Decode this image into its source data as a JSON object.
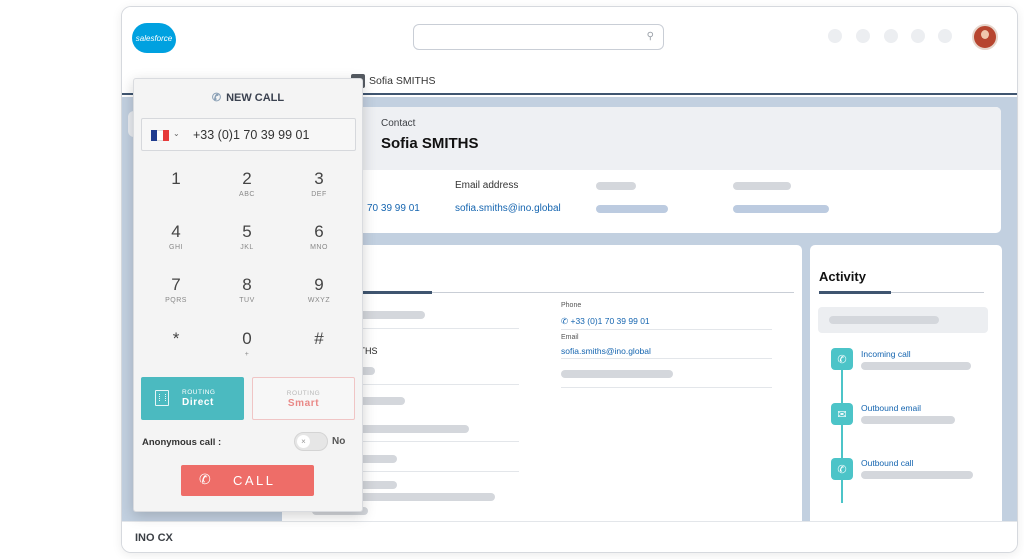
{
  "header": {
    "logo_text": "salesforce",
    "search_icon": "search-icon"
  },
  "tab": {
    "label": "Sofia SMITHS"
  },
  "contact": {
    "kicker": "Contact",
    "name": "Sofia SMITHS",
    "email_label": "Email address",
    "phone_value": "70 39 99 01",
    "email_value": "sofia.smiths@ino.global"
  },
  "details": {
    "phone_label": "Phone",
    "phone_value": "+33 (0)1 70 39 99 01",
    "email_label": "Email",
    "email_value": "sofia.smiths@ino.global",
    "name_fragment": "ITHS"
  },
  "activity": {
    "title": "Activity",
    "items": [
      {
        "label": "Incoming call",
        "icon": "phone-icon"
      },
      {
        "label": "Outbound email",
        "icon": "mail-icon"
      },
      {
        "label": "Outbound call",
        "icon": "phone-icon"
      }
    ]
  },
  "footer": {
    "label": "INO CX"
  },
  "dialer": {
    "title": "NEW CALL",
    "title_icon": "phone-icon",
    "flag_colors": [
      "#1f3c8f",
      "#ffffff",
      "#e63b3b"
    ],
    "number": "+33 (0)1 70 39 99 01",
    "keys": [
      {
        "digit": "1",
        "letters": ""
      },
      {
        "digit": "2",
        "letters": "ABC"
      },
      {
        "digit": "3",
        "letters": "DEF"
      },
      {
        "digit": "4",
        "letters": "GHI"
      },
      {
        "digit": "5",
        "letters": "JKL"
      },
      {
        "digit": "6",
        "letters": "MNO"
      },
      {
        "digit": "7",
        "letters": "PQRS"
      },
      {
        "digit": "8",
        "letters": "TUV"
      },
      {
        "digit": "9",
        "letters": "WXYZ"
      },
      {
        "digit": "*",
        "letters": ""
      },
      {
        "digit": "0",
        "letters": "+"
      },
      {
        "digit": "#",
        "letters": ""
      }
    ],
    "routing_direct": {
      "kicker": "ROUTING",
      "value": "Direct"
    },
    "routing_smart": {
      "kicker": "ROUTING",
      "value": "Smart"
    },
    "anonymous_label": "Anonymous call :",
    "anonymous_value": "No",
    "call_label": "CALL"
  },
  "colors": {
    "accent_teal": "#4bbac0",
    "call_red": "#ee6d68",
    "link_blue": "#1565b0",
    "workspace_blue": "#c2d0e0"
  }
}
